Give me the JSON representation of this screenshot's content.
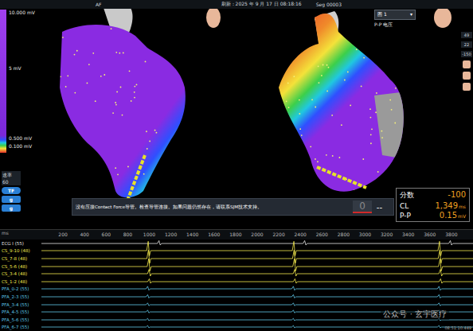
{
  "header": {
    "mode": "AF",
    "refresh": "刷新：2025 年 9 月 17 日 08:18:16",
    "segment": "Seg 00003",
    "map_select": {
      "label": "图 1",
      "arrow": "▾"
    },
    "map_type": "P-P 电压"
  },
  "color_scale": {
    "labels": [
      "10.000 mV",
      "5 mV",
      "0.500 mV",
      "0.100 mV"
    ]
  },
  "side_tools": {
    "rate_label": "速率",
    "rate_value": "60",
    "badges": [
      "TF",
      "g",
      "g"
    ]
  },
  "right_toolbar": {
    "values": [
      "49",
      "22",
      "-150"
    ]
  },
  "message": {
    "text": "没有压接Contact Force导管。检查导管连接。如果问题仍然存在，请联系SJM技术支持。",
    "force": "0",
    "force_secondary": "--"
  },
  "readout": [
    {
      "label": "分数",
      "value": "-100",
      "unit": ""
    },
    {
      "label": "CL",
      "value": "1,349",
      "unit": "ms"
    },
    {
      "label": "P-P",
      "value": "0.15",
      "unit": "mV"
    }
  ],
  "timeline": {
    "start": "ms",
    "span_ms": 4000,
    "ticks": [
      "200",
      "400",
      "600",
      "800",
      "1000",
      "1200",
      "1400",
      "1600",
      "1800",
      "2000",
      "2200",
      "2400",
      "2600",
      "2800",
      "3000",
      "3200",
      "3400",
      "3600",
      "3800"
    ],
    "time": "08:51:10.449"
  },
  "channels": [
    {
      "name": "ECG I (55)",
      "color": "#e6e6e6",
      "amplitude": 0.4,
      "spikes_ms": [
        1090,
        2440,
        3790
      ]
    },
    {
      "name": "CS_9-10 (48)",
      "color": "#f2e94e",
      "amplitude": 1.3,
      "spikes_ms": [
        990,
        2340,
        3690
      ]
    },
    {
      "name": "CS_7-8 (48)",
      "color": "#f2e94e",
      "amplitude": 1.2,
      "spikes_ms": [
        992,
        2342,
        3692
      ]
    },
    {
      "name": "CS_5-6 (48)",
      "color": "#f2e94e",
      "amplitude": 1.1,
      "spikes_ms": [
        995,
        2345,
        3695
      ]
    },
    {
      "name": "CS_3-4 (48)",
      "color": "#f2e94e",
      "amplitude": 0.6,
      "spikes_ms": [
        998,
        2348,
        3698
      ]
    },
    {
      "name": "CS_1-2 (48)",
      "color": "#f2e94e",
      "amplitude": 0.4,
      "spikes_ms": [
        1000,
        2350,
        3700
      ]
    },
    {
      "name": "PFA_0-2 (55)",
      "color": "#5fc8e8",
      "amplitude": 0.35,
      "spikes_ms": [
        985,
        2335,
        3685
      ]
    },
    {
      "name": "PFA_2-3 (55)",
      "color": "#5fc8e8",
      "amplitude": 0.3,
      "spikes_ms": [
        985,
        2335,
        3685
      ]
    },
    {
      "name": "PFA_3-4 (55)",
      "color": "#5fc8e8",
      "amplitude": 0.25,
      "spikes_ms": [
        985,
        2335,
        3685
      ]
    },
    {
      "name": "PFA_4-5 (55)",
      "color": "#5fc8e8",
      "amplitude": 0.25,
      "spikes_ms": [
        985,
        2335,
        3685
      ]
    },
    {
      "name": "PFA_5-6 (55)",
      "color": "#5fc8e8",
      "amplitude": 0.2,
      "spikes_ms": [
        985,
        2335,
        3685
      ]
    },
    {
      "name": "PFA_6-7 (55)",
      "color": "#5fc8e8",
      "amplitude": 0.2,
      "spikes_ms": [
        985,
        2335,
        3685
      ]
    }
  ],
  "watermark": "公众号 · 玄宇医疗"
}
